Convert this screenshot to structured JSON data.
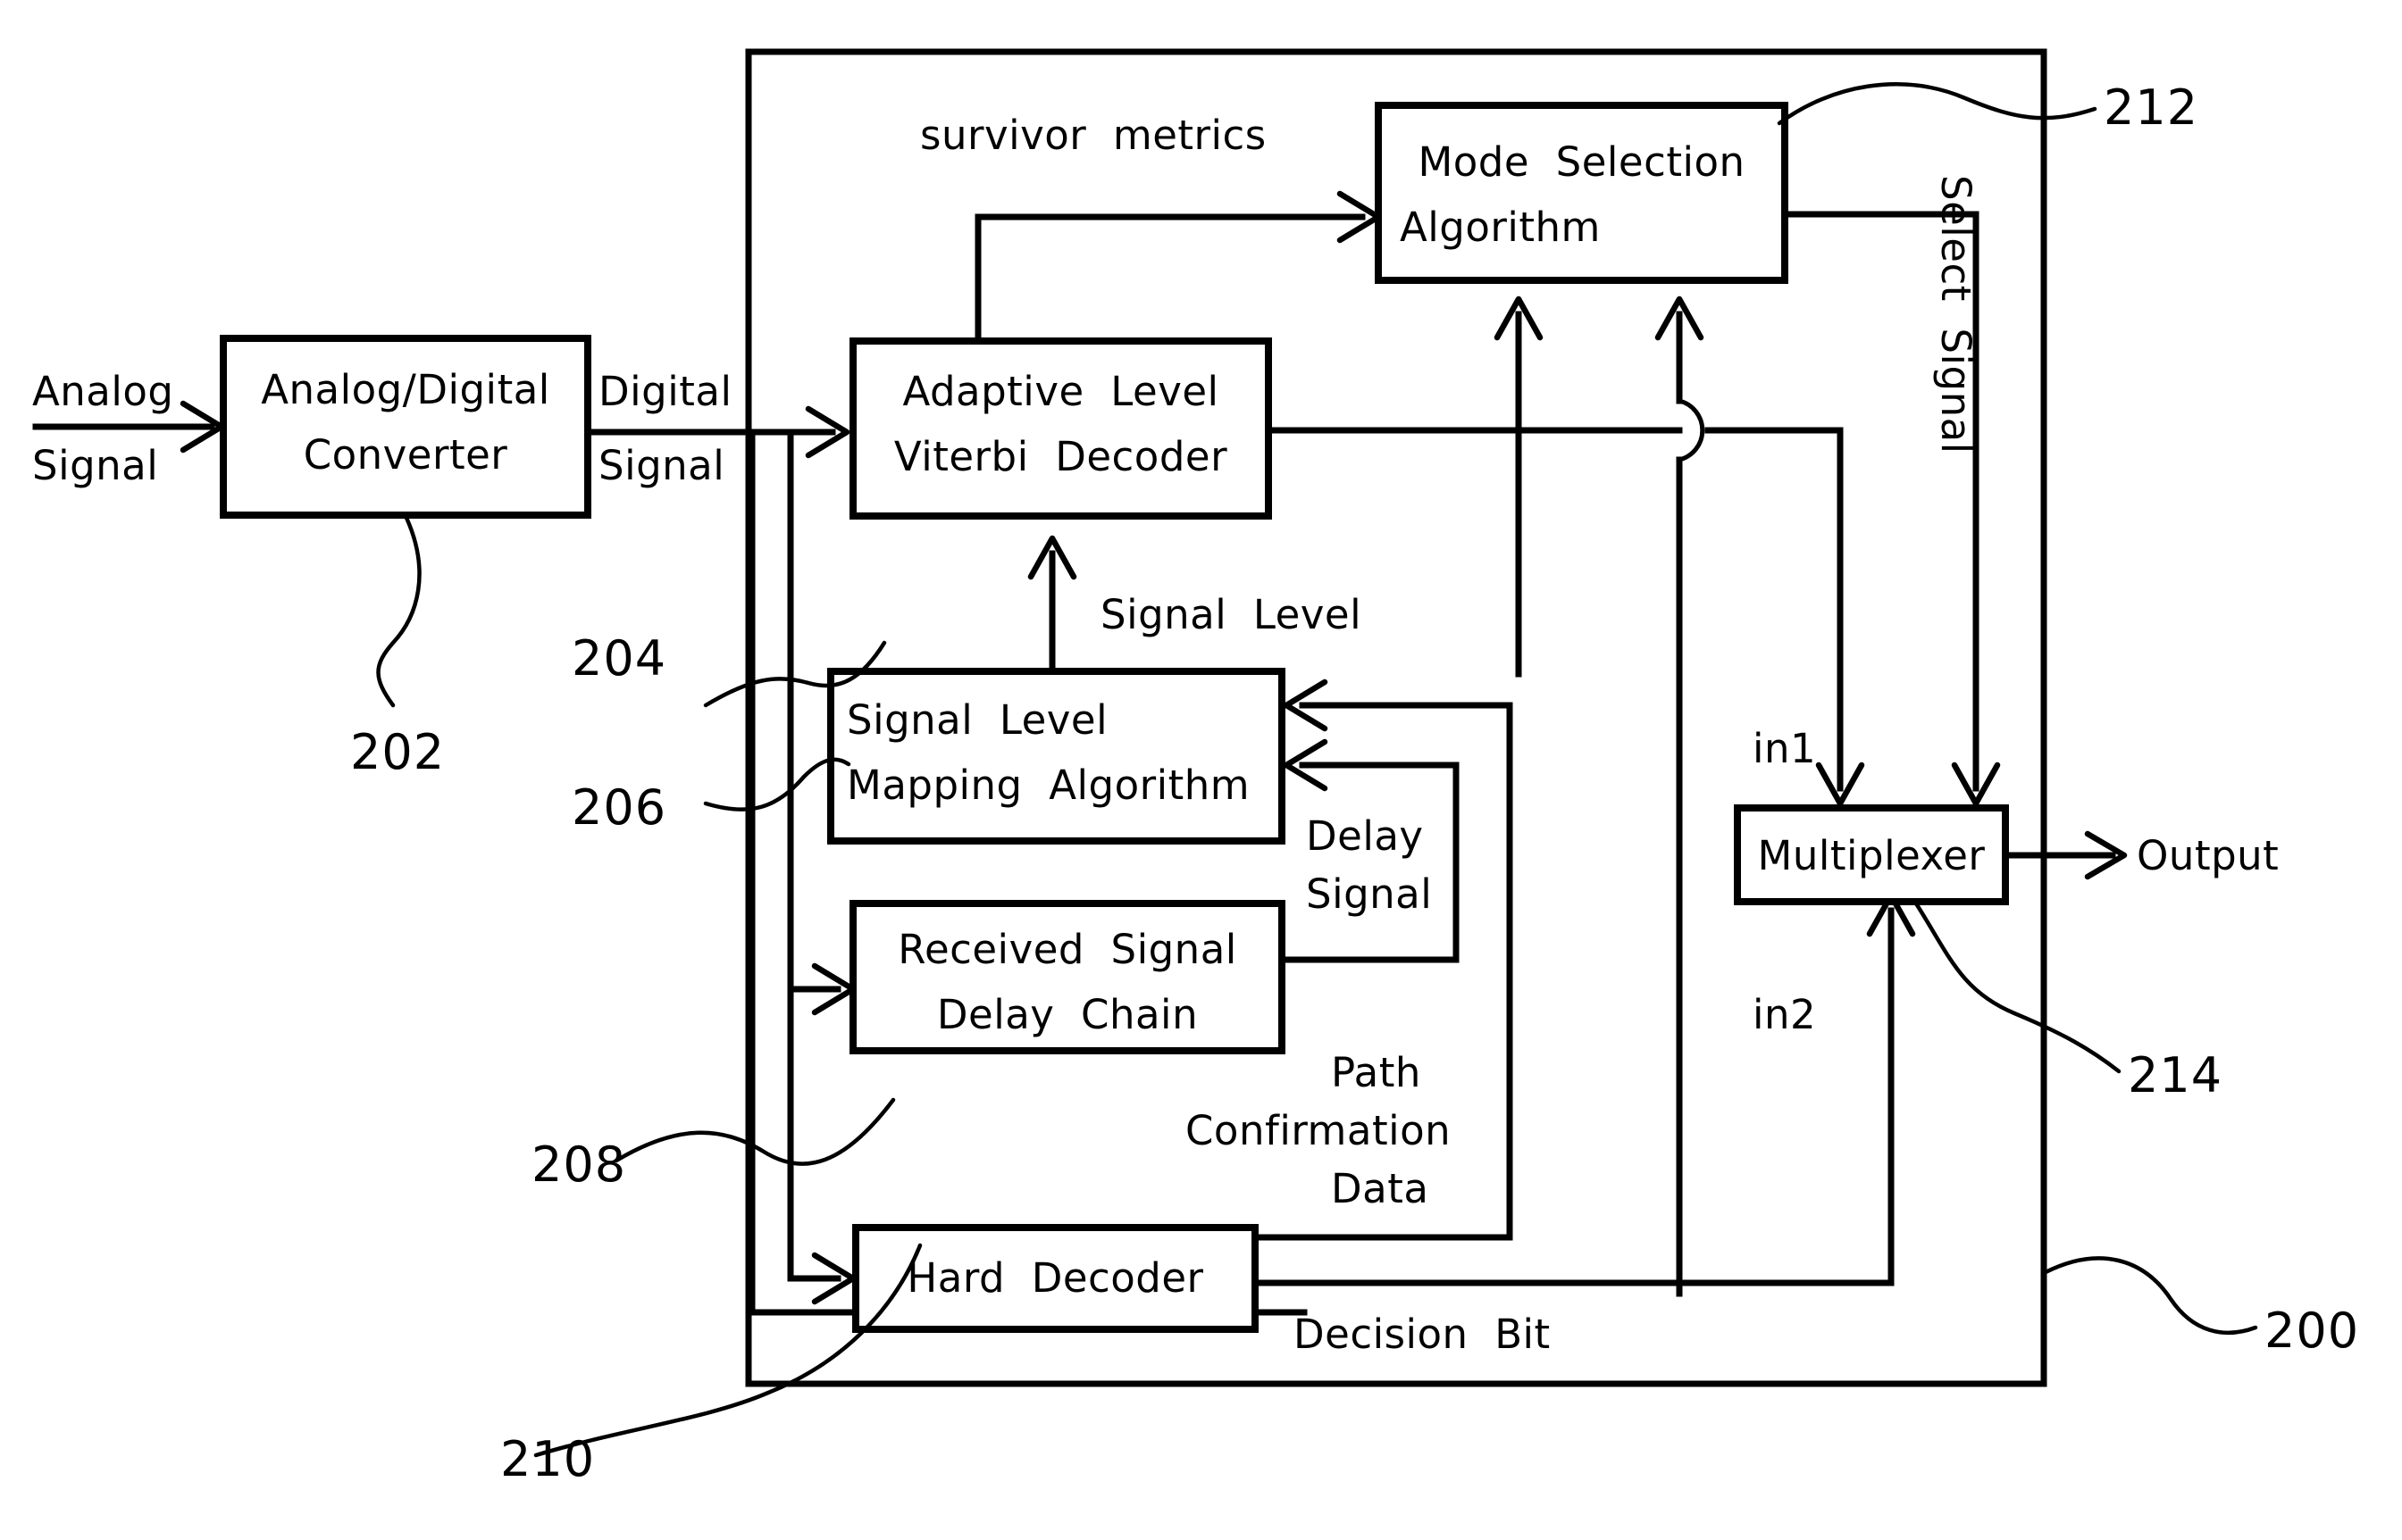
{
  "figure": {
    "type": "patent-block-diagram",
    "system_ref": "200",
    "blocks": [
      {
        "id": "adc",
        "label": "Analog/Digital\nConverter",
        "ref": "202"
      },
      {
        "id": "viterbi",
        "label": "Adaptive  Level\nViterbi  Decoder",
        "ref": "204"
      },
      {
        "id": "slmap",
        "label": "Signal  Level\nMapping  Algorithm",
        "ref": "206"
      },
      {
        "id": "delaychain",
        "label": "Received  Signal\nDelay  Chain",
        "ref": "208"
      },
      {
        "id": "harddec",
        "label": "Hard  Decoder",
        "ref": "210"
      },
      {
        "id": "modesel",
        "label": "Mode  Selection\nAlgorithm",
        "ref": "212"
      },
      {
        "id": "mux",
        "label": "Multiplexer",
        "ref": "214"
      }
    ],
    "block_labels": {
      "adc_line1": "Analog/Digital",
      "adc_line2": "Converter",
      "viterbi_line1": "Adaptive  Level",
      "viterbi_line2": "Viterbi  Decoder",
      "slmap_line1": "Signal  Level",
      "slmap_line2": "Mapping  Algorithm",
      "delaychain_line1": "Received  Signal",
      "delaychain_line2": "Delay  Chain",
      "harddec": "Hard  Decoder",
      "modesel_line1": "Mode  Selection",
      "modesel_line2": "Algorithm",
      "mux": "Multiplexer"
    },
    "signal_labels": {
      "analog_line1": "Analog",
      "analog_line2": "Signal",
      "digital_line1": "Digital",
      "digital_line2": "Signal",
      "survivor_metrics": "survivor  metrics",
      "signal_level": "Signal  Level",
      "delay_line1": "Delay",
      "delay_line2": "Signal",
      "path_line1": "Path",
      "path_line2": "Confirmation",
      "path_line3": "Data",
      "decision_bit": "Decision  Bit",
      "select_signal": "Select  Signal",
      "in1": "in1",
      "in2": "in2",
      "output": "Output"
    },
    "reference_numerals": {
      "system": "200",
      "adc": "202",
      "viterbi": "204",
      "slmap": "206",
      "delaychain": "208",
      "harddec": "210",
      "modesel": "212",
      "mux": "214"
    },
    "colors": {
      "ink": "#000000",
      "paper": "#ffffff"
    }
  }
}
